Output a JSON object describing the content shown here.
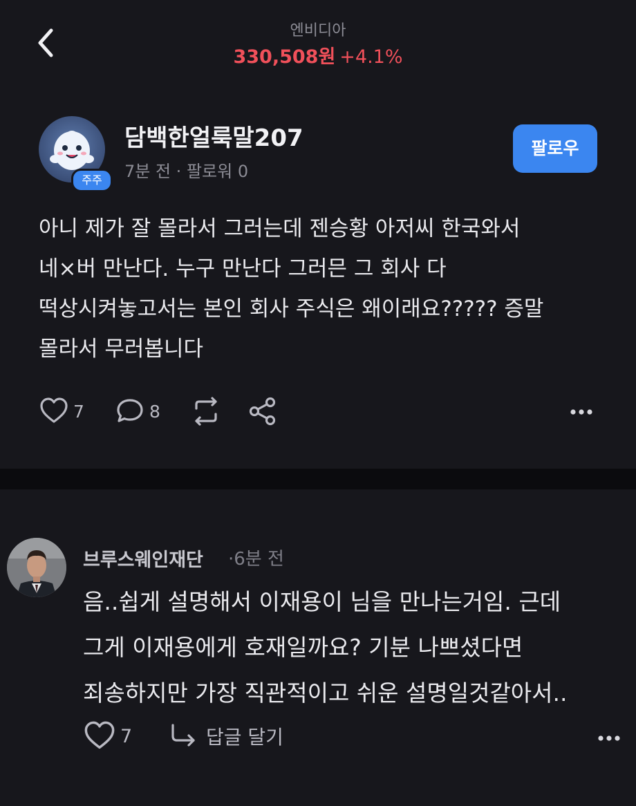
{
  "header": {
    "stock_name": "엔비디아",
    "stock_price": "330,508원",
    "stock_change": "+4.1%",
    "price_color": "#f0505a"
  },
  "post": {
    "author": "담백한얼룩말207",
    "badge": "주주",
    "meta": "7분 전 · 팔로워 0",
    "follow_label": "팔로우",
    "body_lines": [
      "아니 제가 잘 몰라서 그러는데 젠승황 아저씨 한국와서",
      "네×버 만난다. 누구 만난다 그러믄 그 회사 다",
      "떡상시켜놓고서는 본인 회사 주식은 왜이래요????? 증말",
      "몰라서 무러봅니다"
    ],
    "likes": "7",
    "comments": "8",
    "icons": [
      "heart-icon",
      "comment-icon",
      "repost-icon",
      "share-icon",
      "more-icon"
    ]
  },
  "comment": {
    "author": "브루스웨인재단",
    "time": "·6분 전",
    "body_lines": [
      "음..쉽게 설명해서 이재용이 님을 만나는거임. 근데",
      "그게 이재용에게 호재일까요? 기분 나쁘셨다면",
      "죄송하지만 가장 직관적이고 쉬운 설명일것같아서.."
    ],
    "likes": "7",
    "reply_label": "답글 달기"
  },
  "colors": {
    "accent": "#3b86f0",
    "background": "#17171c"
  }
}
